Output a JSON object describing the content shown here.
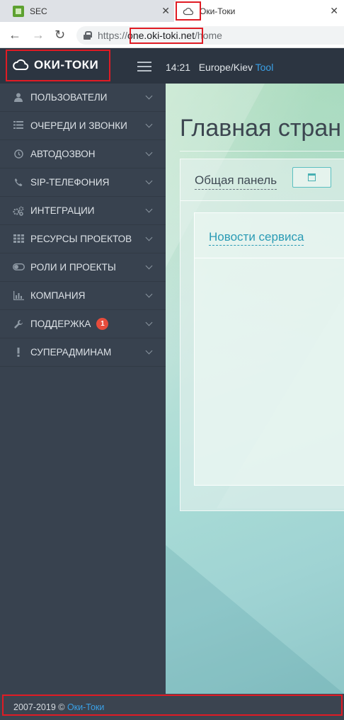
{
  "browser": {
    "tabs": [
      {
        "title": "SEC",
        "close": "✕"
      },
      {
        "title": "Оки-Токи",
        "close": "✕"
      }
    ],
    "nav": {
      "back": "←",
      "forward": "→",
      "reload": "↻"
    },
    "url": {
      "scheme": "https://",
      "host": "one.oki-toki.net",
      "path": "/home"
    }
  },
  "header": {
    "logo": "ОКИ-ТОКИ",
    "time": "14:21",
    "timezone": "Europe/Kiev",
    "tool": "Tool"
  },
  "sidebar": {
    "items": [
      {
        "label": "ПОЛЬЗОВАТЕЛИ",
        "icon": "user-icon"
      },
      {
        "label": "ОЧЕРЕДИ И ЗВОНКИ",
        "icon": "list-icon"
      },
      {
        "label": "АВТОДОЗВОН",
        "icon": "clock-icon"
      },
      {
        "label": "SIP-ТЕЛЕФОНИЯ",
        "icon": "phone-icon"
      },
      {
        "label": "ИНТЕГРАЦИИ",
        "icon": "gears-icon"
      },
      {
        "label": "РЕСУРСЫ ПРОЕКТОВ",
        "icon": "grid-icon"
      },
      {
        "label": "РОЛИ И ПРОЕКТЫ",
        "icon": "toggle-icon"
      },
      {
        "label": "КОМПАНИЯ",
        "icon": "bar-chart-icon"
      },
      {
        "label": "ПОДДЕРЖКА",
        "icon": "wrench-icon",
        "badge": "1"
      },
      {
        "label": "СУПЕРАДМИНАМ",
        "icon": "exclamation-icon"
      }
    ]
  },
  "main": {
    "title": "Главная стран",
    "panel_title": "Общая панель",
    "card_title": "Новости сервиса"
  },
  "footer": {
    "years": "2007-2019 ©",
    "brand": "Оки-Токи"
  },
  "colors": {
    "sidebar": "#38424f",
    "header": "#2c3541",
    "accent": "#3aa0e6",
    "highlight": "#e01b24",
    "badge": "#e74c3c"
  }
}
